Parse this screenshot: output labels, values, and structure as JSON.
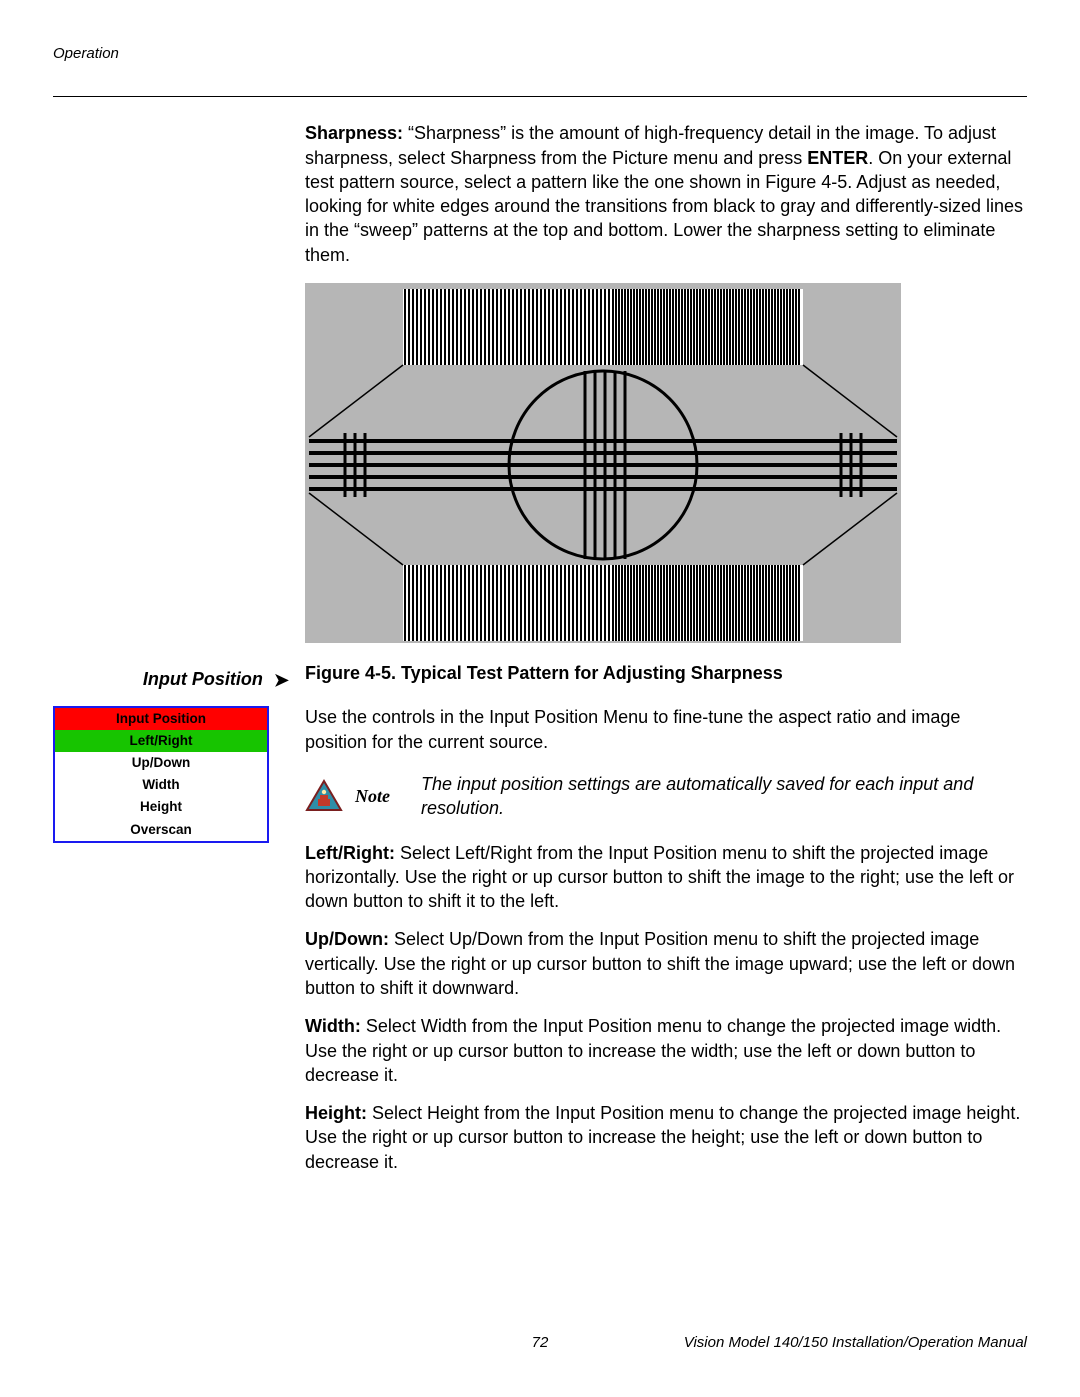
{
  "header": {
    "section": "Operation"
  },
  "sharpness": {
    "label": "Sharpness:",
    "body_before_enter": " “Sharpness” is the amount of high-frequency detail in the image. To adjust sharpness, select Sharpness from the Picture menu and press ",
    "enter": "ENTER",
    "body_after_enter": ". On your external test pattern source, select a pattern like the one shown in Figure 4-5. Adjust as needed, looking for white edges around the transitions from black to gray and differently-sized lines in the “sweep” patterns at the top and bottom. Lower the sharpness setting to eliminate them."
  },
  "figure": {
    "caption": "Figure 4-5. Typical Test Pattern for Adjusting Sharpness"
  },
  "section": {
    "label": "Input Position",
    "intro": "Use the controls in the Input Position Menu to fine-tune the aspect ratio and image position for the current source."
  },
  "osd": {
    "title": "Input Position",
    "highlight": "Left/Right",
    "items": [
      "Up/Down",
      "Width",
      "Height",
      "Overscan"
    ]
  },
  "note": {
    "label": "Note",
    "text": "The input position settings are automatically saved for each input and resolution."
  },
  "paragraphs": {
    "leftright": {
      "label": "Left/Right:",
      "text": " Select Left/Right from the Input Position menu to shift the projected image horizontally. Use the right or up cursor button to shift the image to the right; use the left or down button to shift it to the left."
    },
    "updown": {
      "label": "Up/Down:",
      "text": " Select Up/Down from the Input Position menu to shift the projected image vertically. Use the right or up cursor button to shift the image upward; use the left or down button to shift it downward."
    },
    "width": {
      "label": "Width:",
      "text": " Select Width from the Input Position menu to change the projected image width. Use the right or up cursor button to increase the width; use the left or down button to decrease it."
    },
    "height": {
      "label": "Height:",
      "text": " Select Height from the Input Position menu to change the projected image height. Use the right or up cursor button to increase the height; use the left or down button to decrease it."
    }
  },
  "footer": {
    "page": "72",
    "manual": "Vision Model 140/150 Installation/Operation Manual"
  }
}
